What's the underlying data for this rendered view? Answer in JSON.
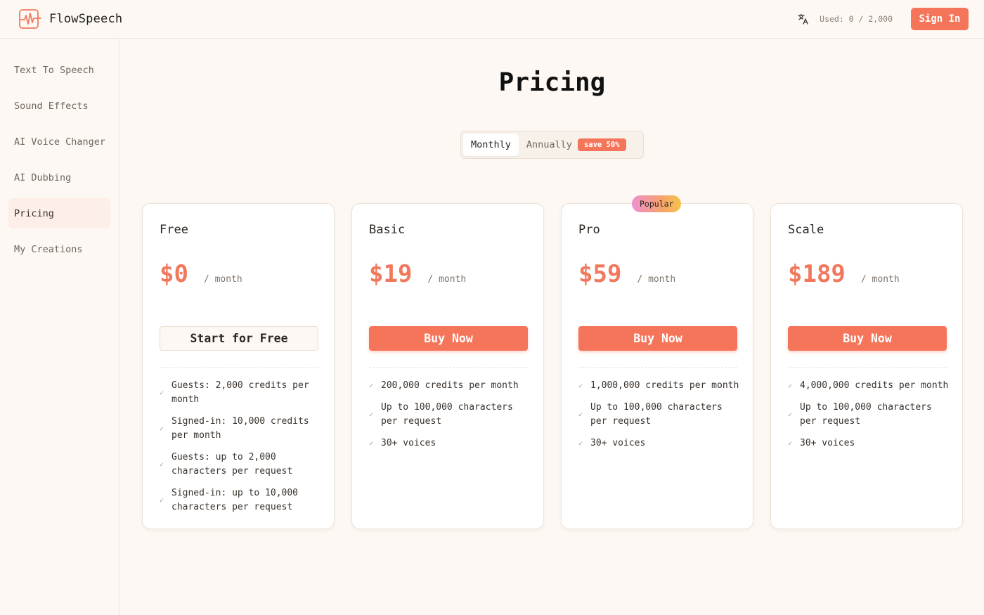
{
  "header": {
    "app_name": "FlowSpeech",
    "usage_text": "Used: 0 / 2,000",
    "signin_label": "Sign In",
    "icons": {
      "logo": "waveform-icon",
      "language": "translate-icon"
    },
    "accent_color": "#f5755a"
  },
  "sidebar": {
    "items": [
      {
        "label": "Text To Speech",
        "active": false
      },
      {
        "label": "Sound Effects",
        "active": false
      },
      {
        "label": "AI Voice Changer",
        "active": false
      },
      {
        "label": "AI Dubbing",
        "active": false
      },
      {
        "label": "Pricing",
        "active": true
      },
      {
        "label": "My Creations",
        "active": false
      }
    ]
  },
  "main": {
    "title": "Pricing",
    "billing_toggle": {
      "monthly_label": "Monthly",
      "annually_label": "Annually",
      "save_badge": "save 50%",
      "selected": "Monthly"
    },
    "plans": [
      {
        "name": "Free",
        "price": "$0",
        "period": "/ month",
        "cta": "Start for Free",
        "features": [
          "Guests: 2,000 credits per month",
          "Signed-in: 10,000 credits per month",
          "Guests: up to 2,000 characters per request",
          "Signed-in: up to 10,000 characters per request"
        ]
      },
      {
        "name": "Basic",
        "price": "$19",
        "period": "/ month",
        "cta": "Buy Now",
        "features": [
          "200,000 credits per month",
          "Up to 100,000 characters per request",
          "30+ voices"
        ]
      },
      {
        "name": "Pro",
        "price": "$59",
        "period": "/ month",
        "cta": "Buy Now",
        "badge": "Popular",
        "features": [
          "1,000,000 credits per month",
          "Up to 100,000 characters per request",
          "30+ voices"
        ]
      },
      {
        "name": "Scale",
        "price": "$189",
        "period": "/ month",
        "cta": "Buy Now",
        "features": [
          "4,000,000 credits per month",
          "Up to 100,000 characters per request",
          "30+ voices"
        ]
      }
    ],
    "check_glyph": "✓"
  }
}
